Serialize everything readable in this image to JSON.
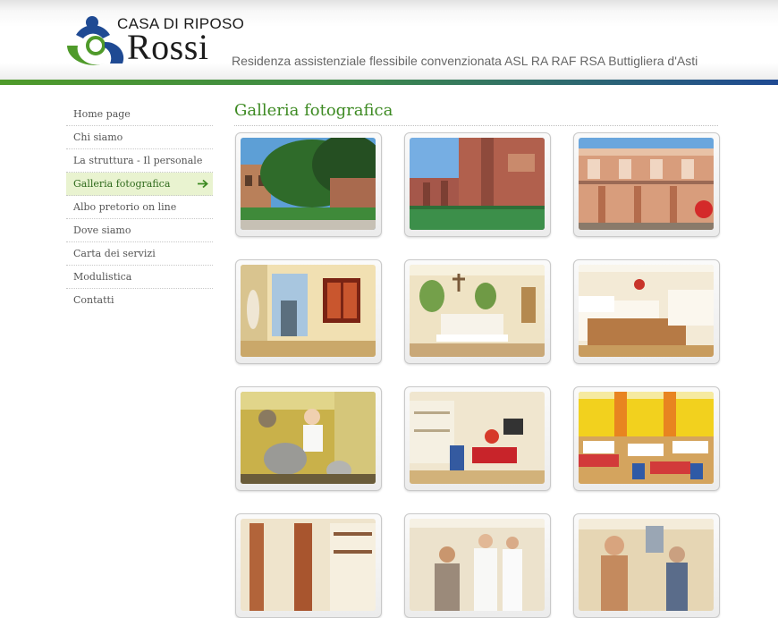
{
  "header": {
    "logo_top": "CASA DI RIPOSO",
    "logo_main": "Rossi",
    "tagline": "Residenza assistenziale flessibile convenzionata ASL RA RAF RSA Buttigliera d'Asti"
  },
  "colors": {
    "brand_green": "#4f9a2a",
    "brand_blue": "#1f4a93",
    "active_bg": "#e9f3d0",
    "title_green": "#3d8a22"
  },
  "sidebar": {
    "items": [
      {
        "label": "Home page",
        "active": false
      },
      {
        "label": "Chi siamo",
        "active": false
      },
      {
        "label": "La struttura - Il personale",
        "active": false
      },
      {
        "label": "Galleria fotografica",
        "active": true,
        "icon": "arrow-right-icon"
      },
      {
        "label": "Albo pretorio on line",
        "active": false
      },
      {
        "label": "Dove siamo",
        "active": false
      },
      {
        "label": "Carta dei servizi",
        "active": false
      },
      {
        "label": "Modulistica",
        "active": false
      },
      {
        "label": "Contatti",
        "active": false
      }
    ]
  },
  "main": {
    "title": "Galleria fotografica",
    "photos": [
      "building-exterior-photo",
      "brick-building-photo",
      "facade-balcony-photo",
      "hallway-photo",
      "chapel-photo",
      "bedroom-photo",
      "kitchen-photo",
      "lounge-photo",
      "dining-room-photo",
      "library-photo",
      "staff-photo",
      "activity-room-photo"
    ]
  }
}
